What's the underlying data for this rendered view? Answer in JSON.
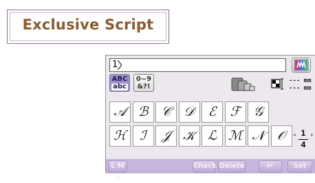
{
  "title": "Exclusive Script",
  "text_entry": {
    "value": "1"
  },
  "tabs": {
    "letters_top": "ABC",
    "letters_bottom": "abc",
    "numbers_top": "0~9",
    "numbers_bottom": "&?!"
  },
  "size_readout": {
    "line1": "--- mm",
    "line2": "--- mm"
  },
  "characters_row1": [
    "𝒜",
    "ℬ",
    "𝒞",
    "𝒟",
    "ℰ",
    "ℱ",
    "𝒢"
  ],
  "characters_row2": [
    "ℋ",
    "ℐ",
    "𝒥",
    "𝒦",
    "ℒ",
    "ℳ",
    "𝒩",
    "𝒪"
  ],
  "page": {
    "current": "1",
    "total": "4"
  },
  "bottom": {
    "lms": "L M S",
    "check": "Check",
    "delete": "Delete",
    "enter": "↵",
    "set": "Set"
  },
  "colors": {
    "panel_bg": "#ece8ed",
    "bottom_bar": "#c5b6dc",
    "selected_tab": "#a08fcf",
    "title_text": "#8a5a30"
  }
}
